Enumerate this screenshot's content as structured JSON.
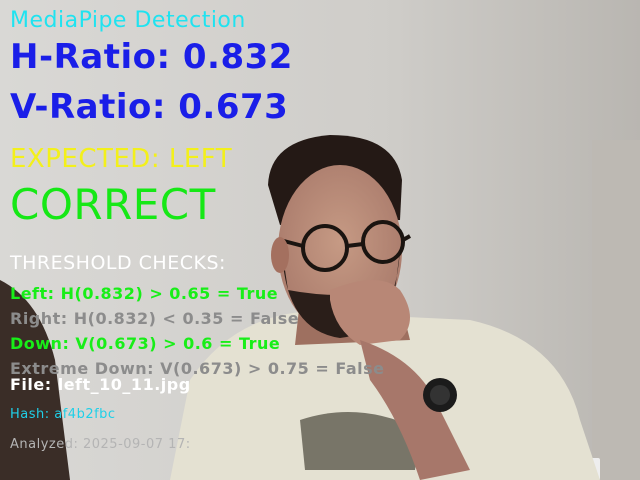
{
  "overlay": {
    "title": "MediaPipe Detection",
    "h_ratio": "H-Ratio: 0.832",
    "v_ratio": "V-Ratio: 0.673",
    "expected": "EXPECTED: LEFT",
    "result": "CORRECT",
    "threshold_heading": "THRESHOLD CHECKS:",
    "checks": [
      "Left: H(0.832) > 0.65 = True",
      "Right: H(0.832) < 0.35 = False",
      "Down: V(0.673) > 0.6 = True",
      "Extreme Down: V(0.673) > 0.75 = False"
    ],
    "file": "File: left_10_11.jpg",
    "hash": "Hash: af4b2fbc",
    "analyzed": "Analyzed: 2025-09-07 17:"
  },
  "colors": {
    "title": "#1fe3f0",
    "ratio": "#1a1ee8",
    "expected": "#f3f01b",
    "correct": "#16e816",
    "check_true": "#18ee18",
    "check_false": "#8c8c8c"
  }
}
